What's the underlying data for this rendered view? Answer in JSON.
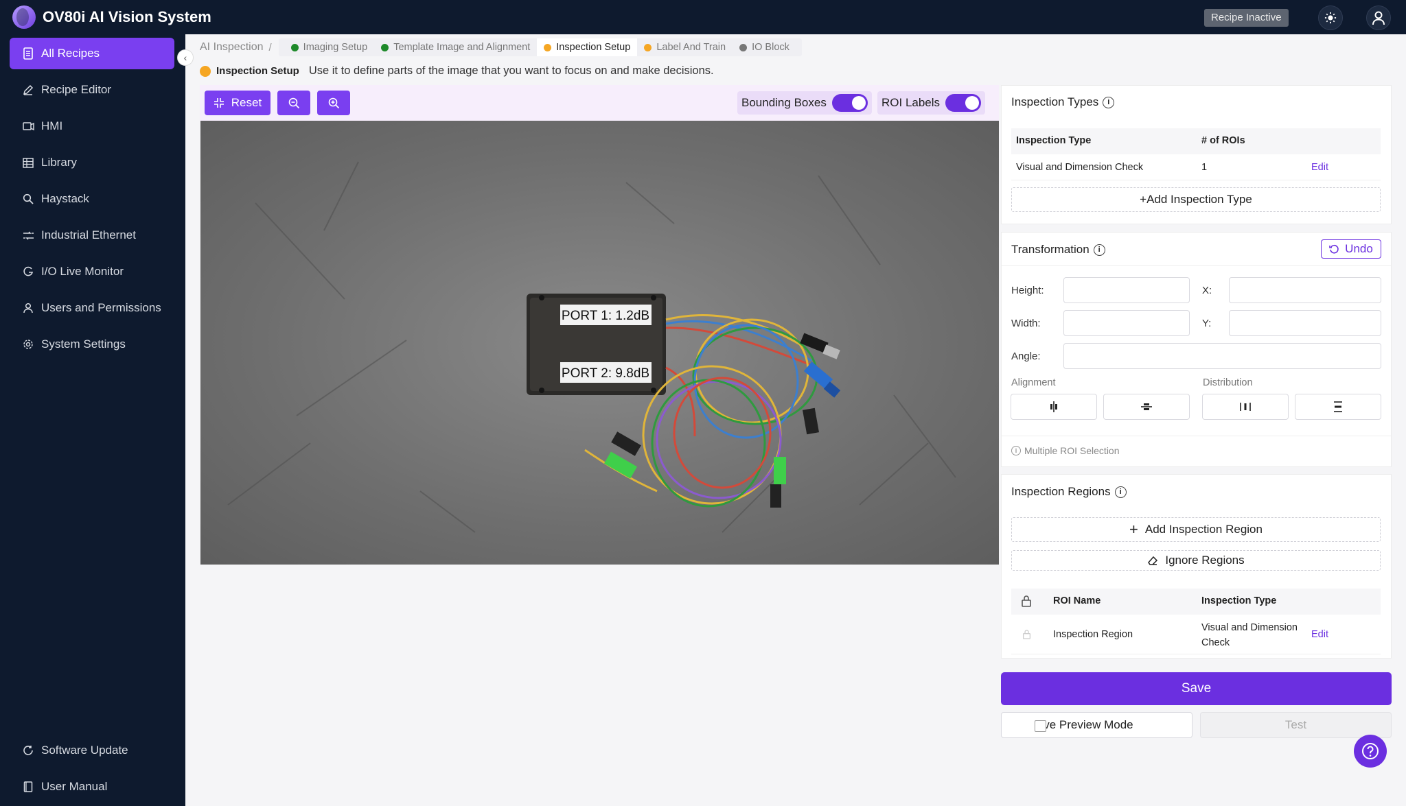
{
  "app": {
    "title": "OV80i AI Vision System",
    "recipe_status": "Recipe Inactive"
  },
  "sidebar": {
    "items": [
      {
        "label": "All Recipes",
        "icon": "document-icon",
        "active": true
      },
      {
        "label": "Recipe Editor",
        "icon": "pencil-icon"
      },
      {
        "label": "HMI",
        "icon": "monitor-icon"
      },
      {
        "label": "Library",
        "icon": "grid-icon"
      },
      {
        "label": "Haystack",
        "icon": "search-icon"
      },
      {
        "label": "Industrial Ethernet",
        "icon": "network-icon"
      },
      {
        "label": "I/O Live Monitor",
        "icon": "monitor-icon"
      },
      {
        "label": "Users and Permissions",
        "icon": "user-icon"
      },
      {
        "label": "System Settings",
        "icon": "gear-icon"
      }
    ],
    "bottom": [
      {
        "label": "Software Update",
        "icon": "refresh-icon"
      },
      {
        "label": "User Manual",
        "icon": "book-icon"
      }
    ]
  },
  "breadcrumb": {
    "root": "AI Inspection",
    "separator": "/",
    "steps": [
      {
        "label": "Imaging Setup",
        "color": "#1e8a2a"
      },
      {
        "label": "Template Image and Alignment",
        "color": "#1e8a2a"
      },
      {
        "label": "Inspection Setup",
        "color": "#f5a623",
        "active": true
      },
      {
        "label": "Label And Train",
        "color": "#f5a623"
      },
      {
        "label": "IO Block",
        "color": "#777777"
      }
    ]
  },
  "description": {
    "title": "Inspection Setup",
    "text": "Use it to define parts of the image that you want to focus on and make decisions."
  },
  "toolbar": {
    "reset_label": "Reset",
    "bounding_boxes_label": "Bounding Boxes",
    "roi_labels_label": "ROI Labels"
  },
  "image": {
    "port1_label": "PORT 1: 1.2dB",
    "port2_label": "PORT 2: 9.8dB"
  },
  "inspection_types": {
    "title": "Inspection Types",
    "columns": [
      "Inspection Type",
      "# of ROIs"
    ],
    "rows": [
      {
        "type": "Visual and Dimension Check",
        "rois": "1",
        "action": "Edit"
      }
    ],
    "add_label": "+Add Inspection Type"
  },
  "transformation": {
    "title": "Transformation",
    "undo_label": "Undo",
    "height_label": "Height:",
    "width_label": "Width:",
    "x_label": "X:",
    "y_label": "Y:",
    "angle_label": "Angle:",
    "alignment_label": "Alignment",
    "distribution_label": "Distribution",
    "multi_select_label": "Multiple ROI Selection"
  },
  "inspection_regions": {
    "title": "Inspection Regions",
    "add_label": "Add Inspection Region",
    "ignore_label": "Ignore Regions",
    "columns": [
      "ROI Name",
      "Inspection Type"
    ],
    "rows": [
      {
        "name": "Inspection Region",
        "type": "Visual and Dimension Check",
        "action": "Edit"
      }
    ]
  },
  "footer": {
    "save_label": "Save",
    "live_preview_label": "Live Preview Mode",
    "test_label": "Test"
  },
  "colors": {
    "accent": "#7a3ff0",
    "nav_bg": "#0e1a2e"
  }
}
